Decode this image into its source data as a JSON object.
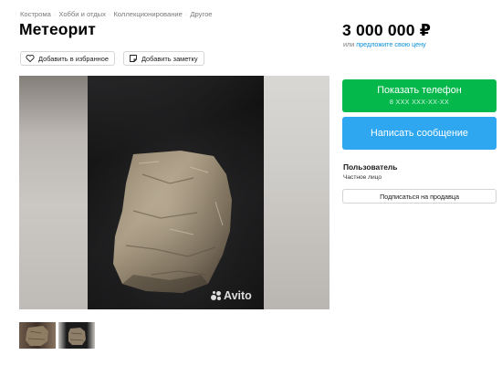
{
  "breadcrumbs": [
    "Кострома",
    "Хобби и отдых",
    "Коллекционирование",
    "Другое"
  ],
  "breadcrumb_separator": "·",
  "title": "Метеорит",
  "actions": {
    "favorite_label": "Добавить в избранное",
    "favorite_icon": "heart-icon",
    "note_label": "Добавить заметку",
    "note_icon": "note-icon"
  },
  "gallery": {
    "watermark": "Avito",
    "thumbnail_count": 2,
    "active_thumbnail": 2
  },
  "price": {
    "value": "3 000 000 ₽",
    "note_prefix": "или",
    "note_link": "предложите свою цену"
  },
  "contact": {
    "phone_label": "Показать телефон",
    "phone_masked": "8 XXX XXX-XX-XX",
    "message_label": "Написать сообщение"
  },
  "seller": {
    "name": "Пользователь",
    "type": "Частное лицо",
    "subscribe_label": "Подписаться на продавца"
  },
  "colors": {
    "phone_button": "#04b84b",
    "message_button": "#2ea7f0",
    "link": "#0a8fd8",
    "thumb_active_border": "#3aa0e8"
  }
}
